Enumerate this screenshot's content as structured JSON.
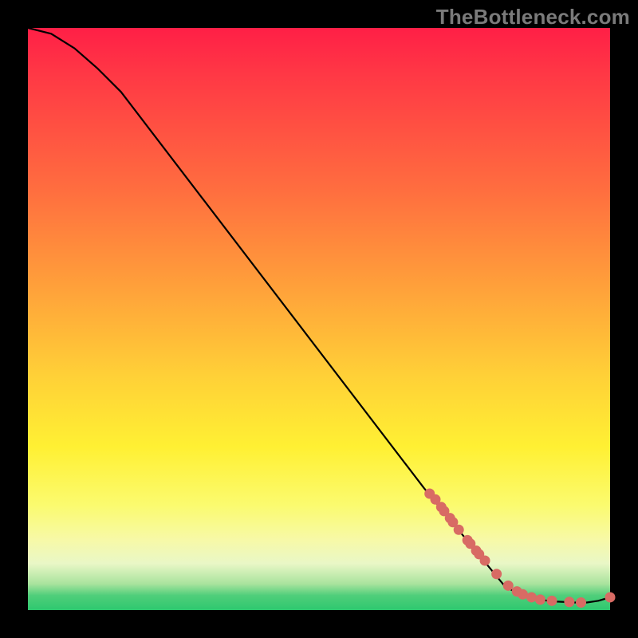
{
  "watermark": "TheBottleneck.com",
  "chart_data": {
    "type": "line",
    "title": "",
    "xlabel": "",
    "ylabel": "",
    "xlim": [
      0,
      100
    ],
    "ylim": [
      0,
      100
    ],
    "grid": false,
    "legend": false,
    "series": [
      {
        "name": "bottleneck-curve",
        "x": [
          0,
          4,
          8,
          12,
          16,
          68,
          82,
          84,
          86,
          88,
          90,
          92,
          94,
          95,
          96,
          98,
          100
        ],
        "y": [
          100,
          99,
          96.5,
          93,
          89,
          21,
          4,
          3,
          2.3,
          1.8,
          1.5,
          1.4,
          1.3,
          1.3,
          1.3,
          1.6,
          2.2
        ]
      }
    ],
    "markers": {
      "name": "highlighted-points",
      "color": "#d86b64",
      "x": [
        69,
        70,
        71,
        71.5,
        72.5,
        73,
        74,
        75.5,
        76,
        77,
        77.5,
        78.5,
        80.5,
        82.5,
        84,
        85,
        86.5,
        88,
        90,
        93,
        95,
        100
      ],
      "y": [
        20,
        19,
        17.7,
        17,
        15.8,
        15.1,
        13.8,
        12,
        11.4,
        10.2,
        9.6,
        8.5,
        6.2,
        4.2,
        3.2,
        2.7,
        2.2,
        1.8,
        1.6,
        1.4,
        1.3,
        2.2
      ]
    }
  }
}
